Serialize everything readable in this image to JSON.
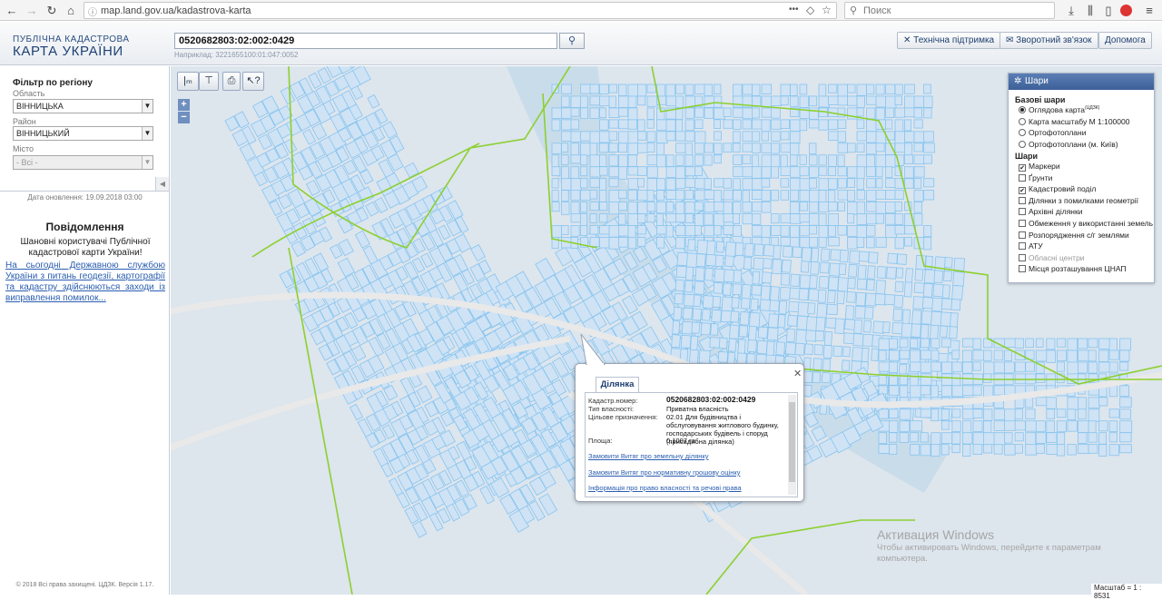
{
  "browser": {
    "url": "map.land.gov.ua/kadastrova-karta",
    "search_placeholder": "Поиск",
    "more": "•••"
  },
  "header": {
    "logo_line1": "ПУБЛІЧНА КАДАСТРОВА",
    "logo_line2": "КАРТА УКРАЇНИ",
    "cadastral_value": "0520682803:02:002:0429",
    "example": "Наприклад: 3221655100:01:047:0052",
    "buttons": {
      "support": "Технічна підтримка",
      "feedback": "Зворотний зв'язок",
      "help": "Допомога"
    }
  },
  "filter": {
    "title": "Фільтр по регіону",
    "region_label": "Область",
    "region_value": "ВІННИЦЬКА",
    "district_label": "Район",
    "district_value": "ВІННИЦЬКИЙ",
    "city_label": "Місто",
    "city_value": "- Всі -"
  },
  "updated": "Дата оновлення: 19.09.2018 03:00",
  "notice": {
    "title": "Повідомлення",
    "body": "Шановні користувачі Публічної кадастрової карти України!",
    "link": "На сьогодні Державною службою України з питань геодезії, картографії та кадастру здійснюються заходи із виправлення помилок..."
  },
  "copyright": "© 2018 Всі права захищені. ЦДЗК. Версія 1.17.",
  "toolbar": {
    "zoom_in": "+",
    "zoom_out": "−"
  },
  "layers": {
    "title": "Шари",
    "base_title": "Базові шари",
    "base": [
      {
        "label": "Оглядова карта",
        "sup": "(ЦДЗК)",
        "on": true
      },
      {
        "label": "Карта масштабу М 1:100000",
        "on": false
      },
      {
        "label": "Ортофотоплани",
        "on": false
      },
      {
        "label": "Ортофотоплани (м. Київ)",
        "on": false
      }
    ],
    "layers_title": "Шари",
    "items": [
      {
        "label": "Маркери",
        "checked": true,
        "disabled": false
      },
      {
        "label": "Ґрунти",
        "checked": false,
        "disabled": false
      },
      {
        "label": "Кадастровий поділ",
        "checked": true,
        "disabled": false
      },
      {
        "label": "Ділянки з помилками геометрії",
        "checked": false,
        "disabled": false
      },
      {
        "label": "Архівні ділянки",
        "checked": false,
        "disabled": false
      },
      {
        "label": "Обмеження у використанні земель",
        "checked": false,
        "disabled": false
      },
      {
        "label": "Розпорядження с/г землями",
        "checked": false,
        "disabled": false
      },
      {
        "label": "АТУ",
        "checked": false,
        "disabled": false
      },
      {
        "label": "Обласні центри",
        "checked": false,
        "disabled": true
      },
      {
        "label": "Місця розташування ЦНАП",
        "checked": false,
        "disabled": false
      }
    ]
  },
  "popup": {
    "tab": "Ділянка",
    "cad_label": "Кадастр.номер:",
    "cad_value": "0520682803:02:002:0429",
    "own_label": "Тип власності:",
    "own_value": "Приватна власність",
    "purpose_label": "Цільове призначення:",
    "purpose_value": "02.01 Для будівництва і обслуговування житлового будинку, господарських будівель і споруд (присадибна ділянка)",
    "area_label": "Площа:",
    "area_value": "0.1007 га",
    "link1": "Замовити Витяг про земельну ділянку",
    "link2": "Замовити Витяг про нормативну грошову оцінку",
    "link3": "Інформація про право власності та речові права"
  },
  "scale": "Масштаб = 1 : 8531",
  "watermark": {
    "title": "Активация Windows",
    "text": "Чтобы активировать Windows, перейдите к параметрам компьютера."
  },
  "colors": {
    "parcel": "#88c4ee",
    "boundary": "#8cd02e",
    "road": "#e9e9e9",
    "river": "#c9dcea"
  }
}
